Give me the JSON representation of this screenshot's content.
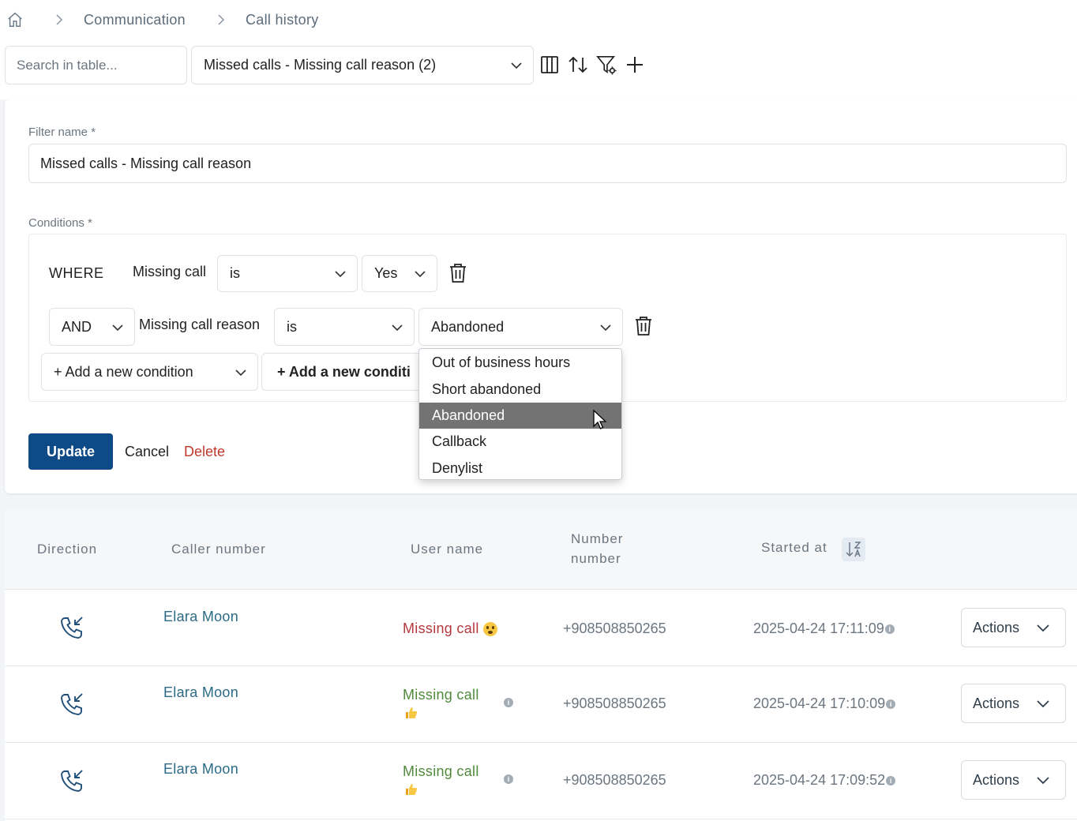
{
  "breadcrumb": {
    "items": [
      "Communication",
      "Call history"
    ]
  },
  "toolbar": {
    "search_placeholder": "Search in table...",
    "filter_selected": "Missed calls - Missing call reason (2)"
  },
  "filter_form": {
    "filter_name_label": "Filter name *",
    "filter_name_value": "Missed calls -  Missing call reason",
    "conditions_label": "Conditions *",
    "row1": {
      "prefix": "WHERE",
      "field": "Missing call",
      "operator": "is",
      "value": "Yes"
    },
    "row2": {
      "prefix": "AND",
      "field": "Missing call reason",
      "operator": "is",
      "value": "Abandoned"
    },
    "add_condition_select": "+ Add a new condition",
    "add_condition_button": "+ Add a new conditi",
    "update_label": "Update",
    "cancel_label": "Cancel",
    "delete_label": "Delete"
  },
  "dropdown": {
    "options": [
      "Out of business hours",
      "Short abandoned",
      "Abandoned",
      "Callback",
      "Denylist"
    ],
    "selected": "Abandoned"
  },
  "table": {
    "headers": {
      "direction": "Direction",
      "caller": "Caller number",
      "user": "User name",
      "number_line1": "Number",
      "number_line2": "number",
      "started": "Started at"
    },
    "rows": [
      {
        "caller": "Elara Moon",
        "status": "Missing call",
        "number": "+908508850265",
        "started": "2025-04-24 17:11:09",
        "actions": "Actions"
      },
      {
        "caller": "Elara Moon",
        "status": "Missing call",
        "number": "+908508850265",
        "started": "2025-04-24 17:10:09",
        "actions": "Actions"
      },
      {
        "caller": "Elara Moon",
        "status": "Missing call",
        "number": "+908508850265",
        "started": "2025-04-24 17:09:52",
        "actions": "Actions"
      }
    ]
  },
  "colors": {
    "primary": "#0e4a85",
    "danger": "#c0392b",
    "missing_red": "#b5383e",
    "missing_green": "#4f8a3a",
    "link": "#2b6a86"
  }
}
